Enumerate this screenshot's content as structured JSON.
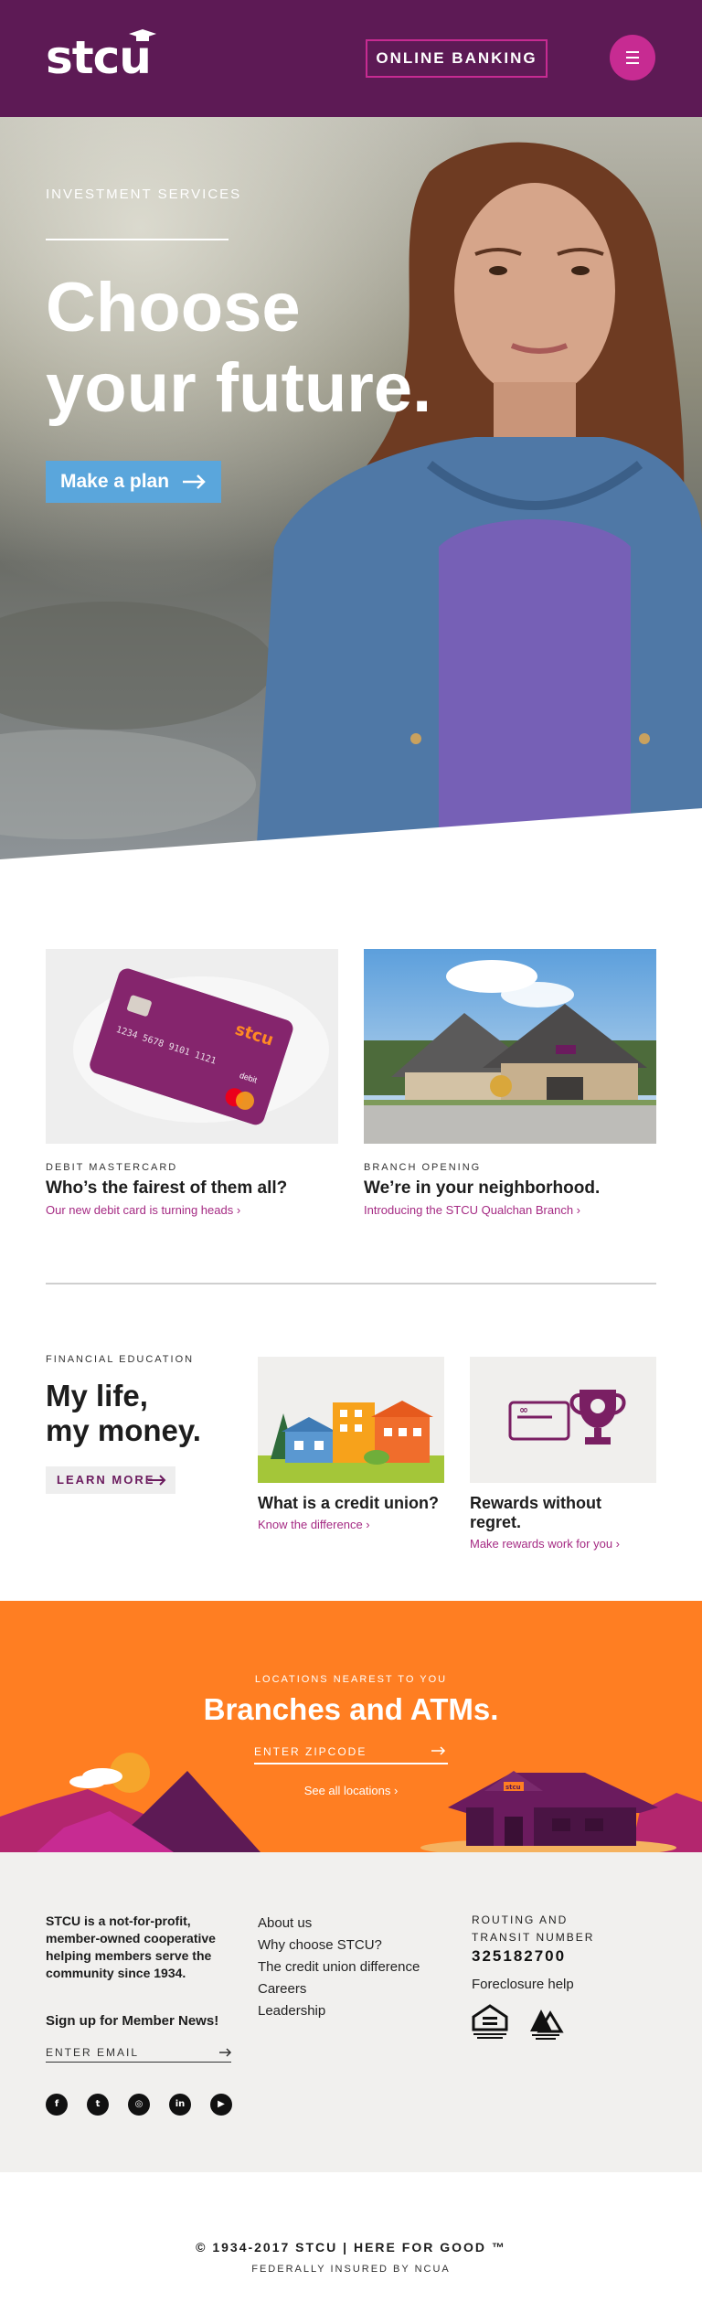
{
  "header": {
    "logo_text": "stcu",
    "online_banking_label": "ONLINE BANKING",
    "menu_icon": "hamburger-icon",
    "brand_color": "#5d1a55",
    "accent_color": "#c72b92"
  },
  "hero": {
    "eyebrow": "INVESTMENT SERVICES",
    "title_line1": "Choose",
    "title_line2": "your future.",
    "cta_label": "Make a plan",
    "cta_color": "#5aa6dc"
  },
  "cards": [
    {
      "eyebrow": "DEBIT MASTERCARD",
      "title": "Who’s the fairest of them all?",
      "link": "Our new debit card is turning heads ›",
      "card_number": "1234 5678 9101 1121",
      "card_brand": "stcu",
      "card_type": "debit"
    },
    {
      "eyebrow": "BRANCH OPENING",
      "title": "We’re in your neighborhood.",
      "link": "Introducing the STCU Qualchan Branch ›"
    }
  ],
  "education": {
    "eyebrow": "FINANCIAL EDUCATION",
    "title_line1": "My life,",
    "title_line2": "my money.",
    "button_label": "LEARN MORE",
    "cards": [
      {
        "title": "What is a credit union?",
        "link": "Know the difference ›"
      },
      {
        "title": "Rewards without regret.",
        "link": "Make rewards work for you ›"
      }
    ]
  },
  "branches": {
    "eyebrow": "LOCATIONS NEAREST TO YOU",
    "title": "Branches and ATMs.",
    "zip_placeholder": "ENTER ZIPCODE",
    "see_all": "See all locations ›",
    "sign_text": "stcu",
    "bg_color": "#ff7e22"
  },
  "footer": {
    "about_text": "STCU is a not-for-profit, member-owned cooperative helping members serve the community since 1934.",
    "signup_label": "Sign up for Member News!",
    "email_placeholder": "ENTER EMAIL",
    "social": [
      {
        "icon": "facebook-icon",
        "glyph": "f"
      },
      {
        "icon": "twitter-icon",
        "glyph": "t"
      },
      {
        "icon": "instagram-icon",
        "glyph": "◎"
      },
      {
        "icon": "linkedin-icon",
        "glyph": "in"
      },
      {
        "icon": "youtube-icon",
        "glyph": "▶"
      }
    ],
    "links": [
      "About us",
      "Why choose STCU?",
      "The credit union difference",
      "Careers",
      "Leadership"
    ],
    "routing_label": "ROUTING AND TRANSIT NUMBER",
    "routing_number": "325182700",
    "foreclosure": "Foreclosure help",
    "badges": [
      "equal-housing-icon",
      "coop-icon"
    ]
  },
  "bottom": {
    "copyright": "© 1934-2017 STCU  |  HERE FOR GOOD ™",
    "ncua": "FEDERALLY INSURED BY NCUA"
  }
}
